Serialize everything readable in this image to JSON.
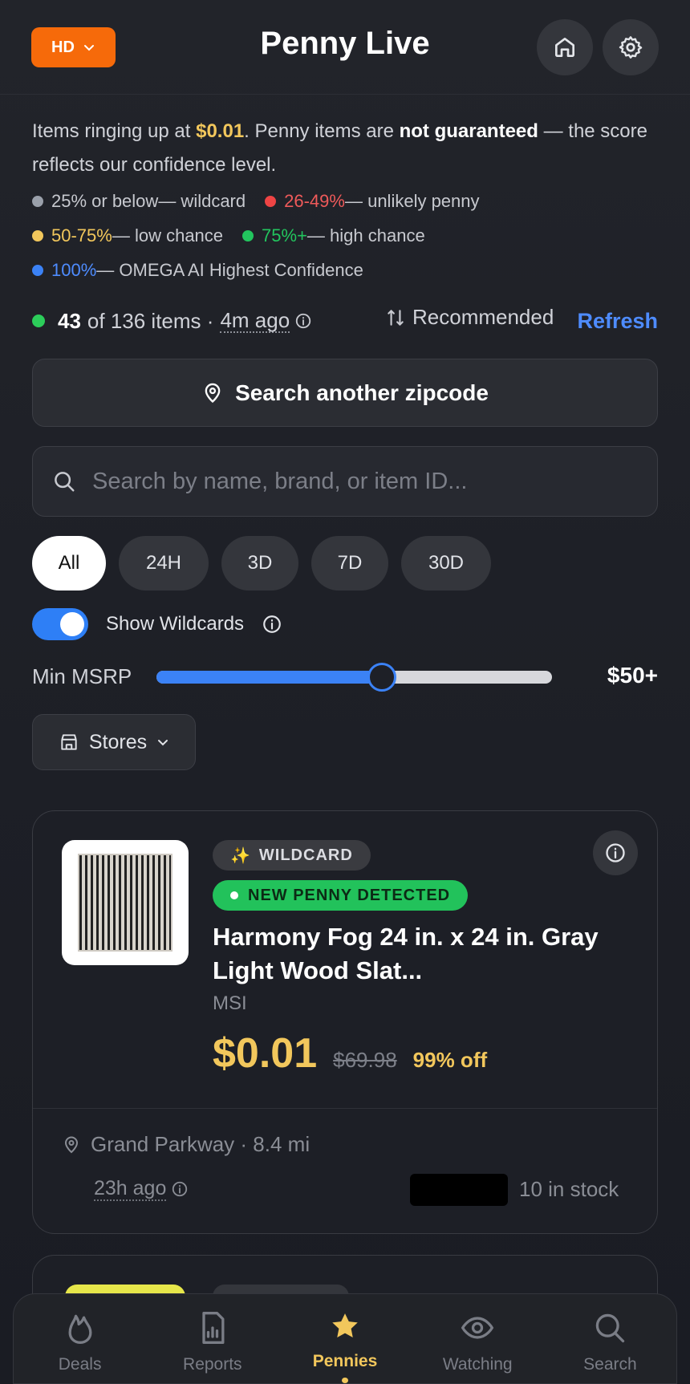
{
  "header": {
    "store_badge": "HD",
    "title": "Penny Live"
  },
  "intro": {
    "line_prefix": "Items ringing up at ",
    "price": "$0.01",
    "line_mid": ". Penny items are ",
    "strong": "not guaranteed",
    "line_suffix": " — the score reflects our confidence level."
  },
  "legend": [
    {
      "range": "25% or below",
      "desc": " — wildcard",
      "color": "#9aa0aa"
    },
    {
      "range": "26-49%",
      "desc": " — unlikely penny",
      "color": "#ef4444"
    },
    {
      "range": "50-75%",
      "desc": " — low chance",
      "color": "#f2c75c"
    },
    {
      "range": "75%+",
      "desc": " — high chance",
      "color": "#22c55e"
    },
    {
      "range": "100%",
      "desc": " — OMEGA AI Highest Confidence",
      "color": "#3b82f6"
    }
  ],
  "stats": {
    "count": "43",
    "total_text": "of 136 items ·",
    "updated": "4m ago",
    "sort_label": "Recommended",
    "refresh_label": "Refresh"
  },
  "zip_button": "Search another zipcode",
  "search": {
    "placeholder": "Search by name, brand, or item ID...",
    "value": ""
  },
  "time_filters": [
    "All",
    "24H",
    "3D",
    "7D",
    "30D"
  ],
  "time_filter_selected": "All",
  "wildcards": {
    "label": "Show Wildcards",
    "enabled": true
  },
  "msrp": {
    "label": "Min MSRP",
    "value_label": "$50+",
    "slider_fraction": 0.57
  },
  "stores_label": "Stores",
  "card": {
    "wildcard_badge": "WILDCARD",
    "new_badge": "NEW PENNY DETECTED",
    "title": "Harmony Fog 24 in. x 24 in. Gray Light Wood Slat...",
    "brand": "MSI",
    "price": "$0.01",
    "original_price": "$69.98",
    "discount": "99% off",
    "location": "Grand Parkway · 8.4 mi",
    "seen": "23h ago",
    "stock": "10 in stock"
  },
  "nav": [
    {
      "label": "Deals",
      "icon": "flame-icon"
    },
    {
      "label": "Reports",
      "icon": "report-icon"
    },
    {
      "label": "Pennies",
      "icon": "star-icon",
      "active": true
    },
    {
      "label": "Watching",
      "icon": "eye-icon"
    },
    {
      "label": "Search",
      "icon": "search-icon"
    }
  ],
  "colors": {
    "accent_orange": "#f66a0a",
    "accent_blue": "#3b82f6",
    "price_gold": "#f2c75c",
    "success_green": "#22c25b"
  }
}
